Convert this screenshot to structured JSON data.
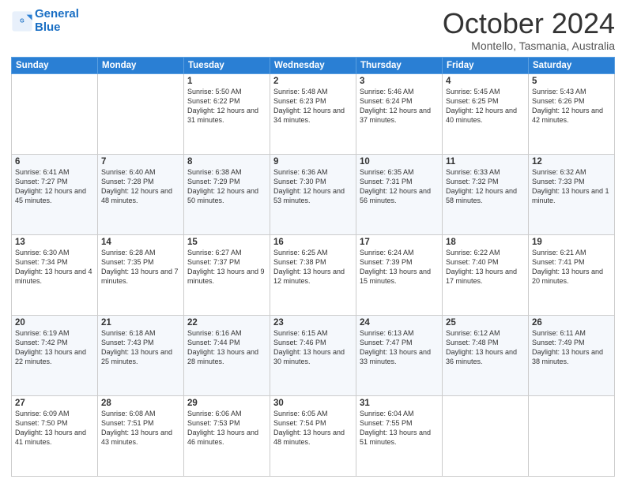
{
  "logo": {
    "line1": "General",
    "line2": "Blue"
  },
  "title": "October 2024",
  "subtitle": "Montello, Tasmania, Australia",
  "days_of_week": [
    "Sunday",
    "Monday",
    "Tuesday",
    "Wednesday",
    "Thursday",
    "Friday",
    "Saturday"
  ],
  "weeks": [
    [
      {
        "day": "",
        "info": ""
      },
      {
        "day": "",
        "info": ""
      },
      {
        "day": "1",
        "info": "Sunrise: 5:50 AM\nSunset: 6:22 PM\nDaylight: 12 hours and 31 minutes."
      },
      {
        "day": "2",
        "info": "Sunrise: 5:48 AM\nSunset: 6:23 PM\nDaylight: 12 hours and 34 minutes."
      },
      {
        "day": "3",
        "info": "Sunrise: 5:46 AM\nSunset: 6:24 PM\nDaylight: 12 hours and 37 minutes."
      },
      {
        "day": "4",
        "info": "Sunrise: 5:45 AM\nSunset: 6:25 PM\nDaylight: 12 hours and 40 minutes."
      },
      {
        "day": "5",
        "info": "Sunrise: 5:43 AM\nSunset: 6:26 PM\nDaylight: 12 hours and 42 minutes."
      }
    ],
    [
      {
        "day": "6",
        "info": "Sunrise: 6:41 AM\nSunset: 7:27 PM\nDaylight: 12 hours and 45 minutes."
      },
      {
        "day": "7",
        "info": "Sunrise: 6:40 AM\nSunset: 7:28 PM\nDaylight: 12 hours and 48 minutes."
      },
      {
        "day": "8",
        "info": "Sunrise: 6:38 AM\nSunset: 7:29 PM\nDaylight: 12 hours and 50 minutes."
      },
      {
        "day": "9",
        "info": "Sunrise: 6:36 AM\nSunset: 7:30 PM\nDaylight: 12 hours and 53 minutes."
      },
      {
        "day": "10",
        "info": "Sunrise: 6:35 AM\nSunset: 7:31 PM\nDaylight: 12 hours and 56 minutes."
      },
      {
        "day": "11",
        "info": "Sunrise: 6:33 AM\nSunset: 7:32 PM\nDaylight: 12 hours and 58 minutes."
      },
      {
        "day": "12",
        "info": "Sunrise: 6:32 AM\nSunset: 7:33 PM\nDaylight: 13 hours and 1 minute."
      }
    ],
    [
      {
        "day": "13",
        "info": "Sunrise: 6:30 AM\nSunset: 7:34 PM\nDaylight: 13 hours and 4 minutes."
      },
      {
        "day": "14",
        "info": "Sunrise: 6:28 AM\nSunset: 7:35 PM\nDaylight: 13 hours and 7 minutes."
      },
      {
        "day": "15",
        "info": "Sunrise: 6:27 AM\nSunset: 7:37 PM\nDaylight: 13 hours and 9 minutes."
      },
      {
        "day": "16",
        "info": "Sunrise: 6:25 AM\nSunset: 7:38 PM\nDaylight: 13 hours and 12 minutes."
      },
      {
        "day": "17",
        "info": "Sunrise: 6:24 AM\nSunset: 7:39 PM\nDaylight: 13 hours and 15 minutes."
      },
      {
        "day": "18",
        "info": "Sunrise: 6:22 AM\nSunset: 7:40 PM\nDaylight: 13 hours and 17 minutes."
      },
      {
        "day": "19",
        "info": "Sunrise: 6:21 AM\nSunset: 7:41 PM\nDaylight: 13 hours and 20 minutes."
      }
    ],
    [
      {
        "day": "20",
        "info": "Sunrise: 6:19 AM\nSunset: 7:42 PM\nDaylight: 13 hours and 22 minutes."
      },
      {
        "day": "21",
        "info": "Sunrise: 6:18 AM\nSunset: 7:43 PM\nDaylight: 13 hours and 25 minutes."
      },
      {
        "day": "22",
        "info": "Sunrise: 6:16 AM\nSunset: 7:44 PM\nDaylight: 13 hours and 28 minutes."
      },
      {
        "day": "23",
        "info": "Sunrise: 6:15 AM\nSunset: 7:46 PM\nDaylight: 13 hours and 30 minutes."
      },
      {
        "day": "24",
        "info": "Sunrise: 6:13 AM\nSunset: 7:47 PM\nDaylight: 13 hours and 33 minutes."
      },
      {
        "day": "25",
        "info": "Sunrise: 6:12 AM\nSunset: 7:48 PM\nDaylight: 13 hours and 36 minutes."
      },
      {
        "day": "26",
        "info": "Sunrise: 6:11 AM\nSunset: 7:49 PM\nDaylight: 13 hours and 38 minutes."
      }
    ],
    [
      {
        "day": "27",
        "info": "Sunrise: 6:09 AM\nSunset: 7:50 PM\nDaylight: 13 hours and 41 minutes."
      },
      {
        "day": "28",
        "info": "Sunrise: 6:08 AM\nSunset: 7:51 PM\nDaylight: 13 hours and 43 minutes."
      },
      {
        "day": "29",
        "info": "Sunrise: 6:06 AM\nSunset: 7:53 PM\nDaylight: 13 hours and 46 minutes."
      },
      {
        "day": "30",
        "info": "Sunrise: 6:05 AM\nSunset: 7:54 PM\nDaylight: 13 hours and 48 minutes."
      },
      {
        "day": "31",
        "info": "Sunrise: 6:04 AM\nSunset: 7:55 PM\nDaylight: 13 hours and 51 minutes."
      },
      {
        "day": "",
        "info": ""
      },
      {
        "day": "",
        "info": ""
      }
    ]
  ]
}
